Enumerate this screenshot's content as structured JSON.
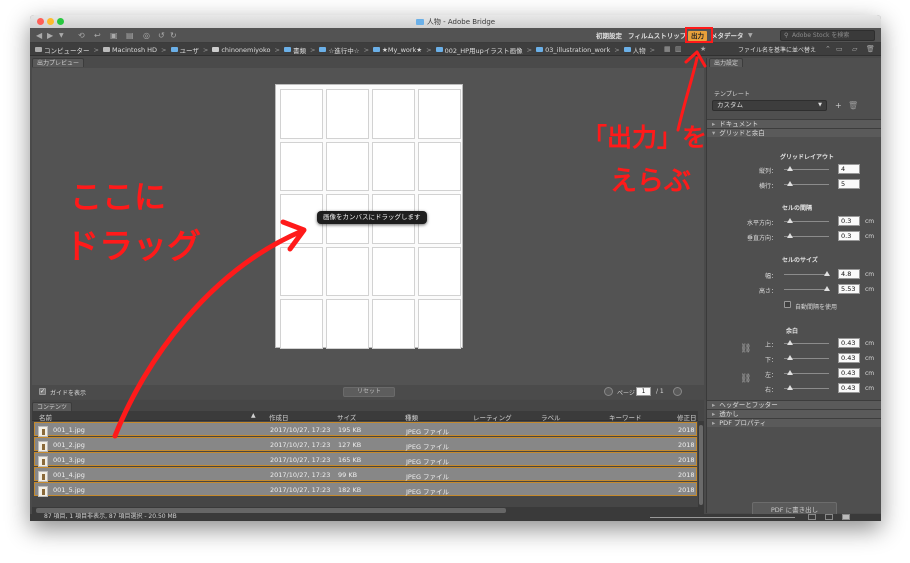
{
  "window": {
    "title": "人物 - Adobe Bridge"
  },
  "workspaces": {
    "items": [
      "初期設定",
      "フィルムストリップ",
      "出力",
      "メタデータ"
    ],
    "active": "出力",
    "search_placeholder": "Adobe Stock を検索"
  },
  "path": {
    "items": [
      "コンピューター",
      "Macintosh HD",
      "ユーザ",
      "chinonemiyoko",
      "書類",
      "☆進行中☆",
      "★My_work★",
      "002_HP用upイラスト画像",
      "03_illustration_work",
      "人物"
    ],
    "sort_label": "ファイル名を基準に並べ替え"
  },
  "preview": {
    "tab": "出力プレビュー",
    "drag_message": "画像をカンバスにドラッグします",
    "show_guides": "ガイドを表示",
    "reset": "リセット",
    "page_label": "ページ",
    "page_current": "1",
    "page_total": "/ 1"
  },
  "content": {
    "tab": "コンテンツ",
    "columns": [
      "名前",
      "作成日",
      "サイズ",
      "種類",
      "レーティング",
      "ラベル",
      "キーワード",
      "修正日"
    ],
    "rows": [
      {
        "name": "001_1.jpg",
        "date": "2017/10/27, 17:23",
        "size": "195 KB",
        "type": "JPEG ファイル",
        "modified": "2018"
      },
      {
        "name": "001_2.jpg",
        "date": "2017/10/27, 17:23",
        "size": "127 KB",
        "type": "JPEG ファイル",
        "modified": "2018"
      },
      {
        "name": "001_3.jpg",
        "date": "2017/10/27, 17:23",
        "size": "165 KB",
        "type": "JPEG ファイル",
        "modified": "2018"
      },
      {
        "name": "001_4.jpg",
        "date": "2017/10/27, 17:23",
        "size": "99 KB",
        "type": "JPEG ファイル",
        "modified": "2018"
      },
      {
        "name": "001_5.jpg",
        "date": "2017/10/27, 17:23",
        "size": "182 KB",
        "type": "JPEG ファイル",
        "modified": "2018"
      }
    ]
  },
  "output_panel": {
    "tab": "出力設定",
    "template_label": "テンプレート",
    "template_value": "カスタム",
    "sections": {
      "document": "ドキュメント",
      "grid_margin": "グリッドと余白",
      "header_footer": "ヘッダーとフッター",
      "watermark": "透かし",
      "pdf_props": "PDF プロパティ"
    },
    "grid_layout": {
      "heading": "グリッドレイアウト",
      "columns_label": "縦列：",
      "columns": "4",
      "rows_label": "横行：",
      "rows": "5"
    },
    "cell_spacing": {
      "heading": "セルの間隔",
      "h_label": "水平方向：",
      "h": "0.3",
      "v_label": "垂直方向：",
      "v": "0.3",
      "unit": "cm"
    },
    "cell_size": {
      "heading": "セルのサイズ",
      "w_label": "幅：",
      "w": "4.8",
      "h_label": "高さ：",
      "h": "5.53",
      "auto_spacing": "自動間隔を使用",
      "unit": "cm"
    },
    "margins": {
      "heading": "余白",
      "top_label": "上：",
      "top": "0.43",
      "bottom_label": "下：",
      "bottom": "0.43",
      "left_label": "左：",
      "left": "0.43",
      "right_label": "右：",
      "right": "0.43",
      "unit": "cm"
    },
    "export_button": "PDF に書き出し"
  },
  "status": {
    "text": "87 項目, 1 項目非表示, 87 項目選択 - 20.50 MB"
  },
  "annotations": {
    "drag_here_line1": "ここに",
    "drag_here_line2": "ドラッグ",
    "choose_output_line1": "「出力」を",
    "choose_output_line2": "えらぶ",
    "color": "#ff1a1a"
  }
}
